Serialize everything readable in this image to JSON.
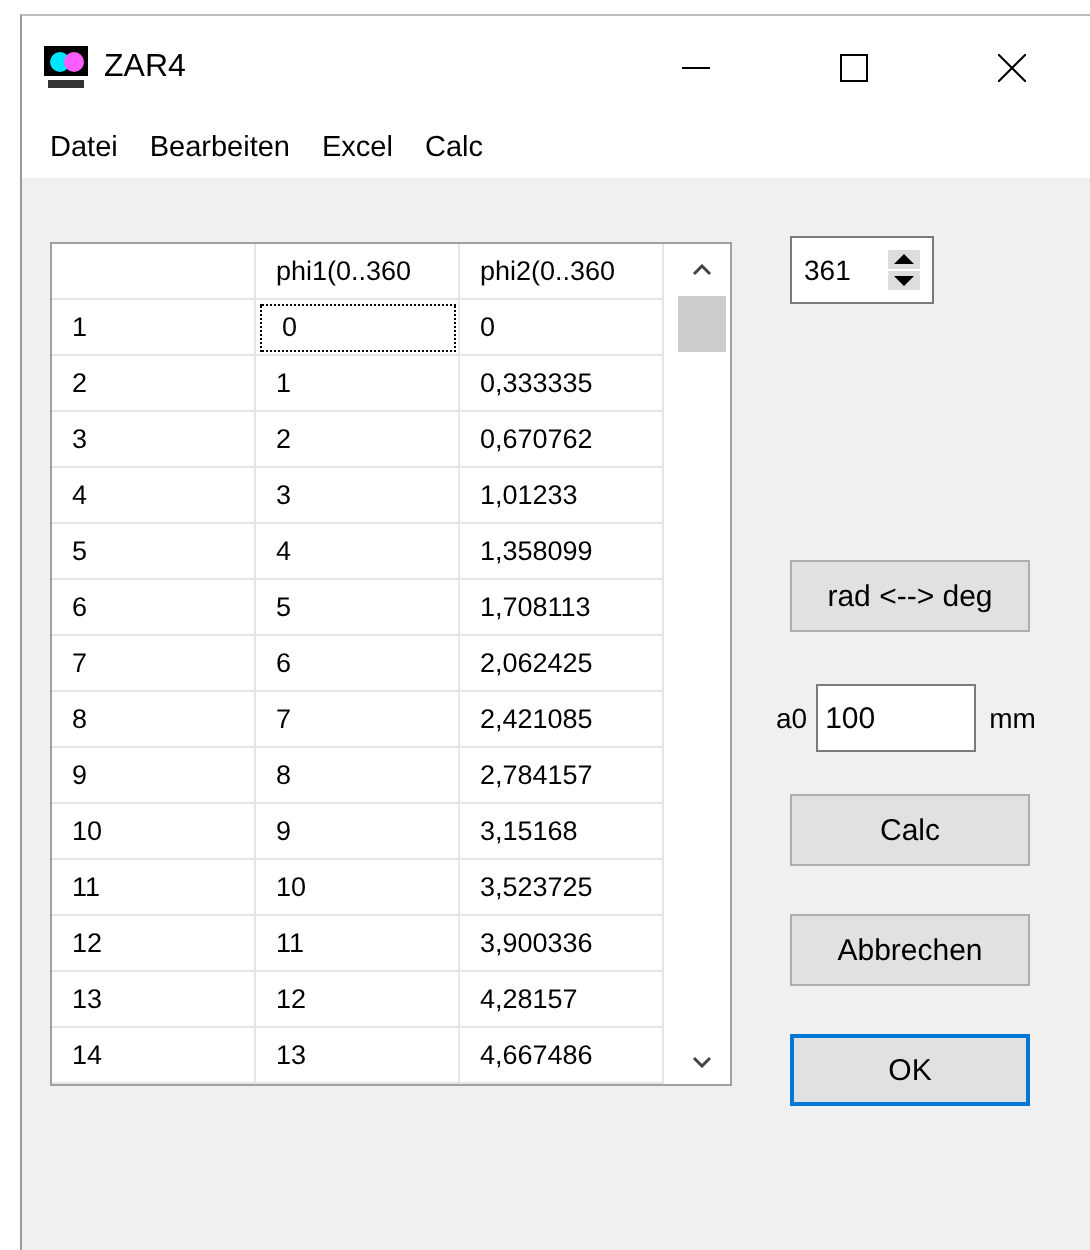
{
  "window": {
    "title": "ZAR4"
  },
  "menu": [
    "Datei",
    "Bearbeiten",
    "Excel",
    "Calc"
  ],
  "grid": {
    "columns": [
      "phi1(0..360",
      "phi2(0..360"
    ],
    "rows": [
      {
        "label": "1",
        "cells": [
          {
            "text": "0",
            "focused": true
          },
          {
            "text": "0",
            "focused": false
          }
        ]
      },
      {
        "label": "2",
        "cells": [
          {
            "text": "1",
            "focused": false
          },
          {
            "text": "0,333335",
            "focused": false
          }
        ]
      },
      {
        "label": "3",
        "cells": [
          {
            "text": "2",
            "focused": false
          },
          {
            "text": "0,670762",
            "focused": false
          }
        ]
      },
      {
        "label": "4",
        "cells": [
          {
            "text": "3",
            "focused": false
          },
          {
            "text": "1,01233",
            "focused": false
          }
        ]
      },
      {
        "label": "5",
        "cells": [
          {
            "text": "4",
            "focused": false
          },
          {
            "text": "1,358099",
            "focused": false
          }
        ]
      },
      {
        "label": "6",
        "cells": [
          {
            "text": "5",
            "focused": false
          },
          {
            "text": "1,708113",
            "focused": false
          }
        ]
      },
      {
        "label": "7",
        "cells": [
          {
            "text": "6",
            "focused": false
          },
          {
            "text": "2,062425",
            "focused": false
          }
        ]
      },
      {
        "label": "8",
        "cells": [
          {
            "text": "7",
            "focused": false
          },
          {
            "text": "2,421085",
            "focused": false
          }
        ]
      },
      {
        "label": "9",
        "cells": [
          {
            "text": "8",
            "focused": false
          },
          {
            "text": "2,784157",
            "focused": false
          }
        ]
      },
      {
        "label": "10",
        "cells": [
          {
            "text": "9",
            "focused": false
          },
          {
            "text": "3,15168",
            "focused": false
          }
        ]
      },
      {
        "label": "11",
        "cells": [
          {
            "text": "10",
            "focused": false
          },
          {
            "text": "3,523725",
            "focused": false
          }
        ]
      },
      {
        "label": "12",
        "cells": [
          {
            "text": "11",
            "focused": false
          },
          {
            "text": "3,900336",
            "focused": false
          }
        ]
      },
      {
        "label": "13",
        "cells": [
          {
            "text": "12",
            "focused": false
          },
          {
            "text": "4,28157",
            "focused": false
          }
        ]
      },
      {
        "label": "14",
        "cells": [
          {
            "text": "13",
            "focused": false
          },
          {
            "text": "4,667486",
            "focused": false
          }
        ]
      }
    ]
  },
  "count_spinner": {
    "value": "361"
  },
  "convert_button": {
    "label": "rad <--> deg",
    "default": false
  },
  "a0": {
    "label": "a0",
    "value": "100",
    "unit": "mm"
  },
  "buttons": [
    {
      "label": "Calc",
      "default": false
    },
    {
      "label": "Abbrechen",
      "default": false
    },
    {
      "label": "OK",
      "default": true
    }
  ]
}
